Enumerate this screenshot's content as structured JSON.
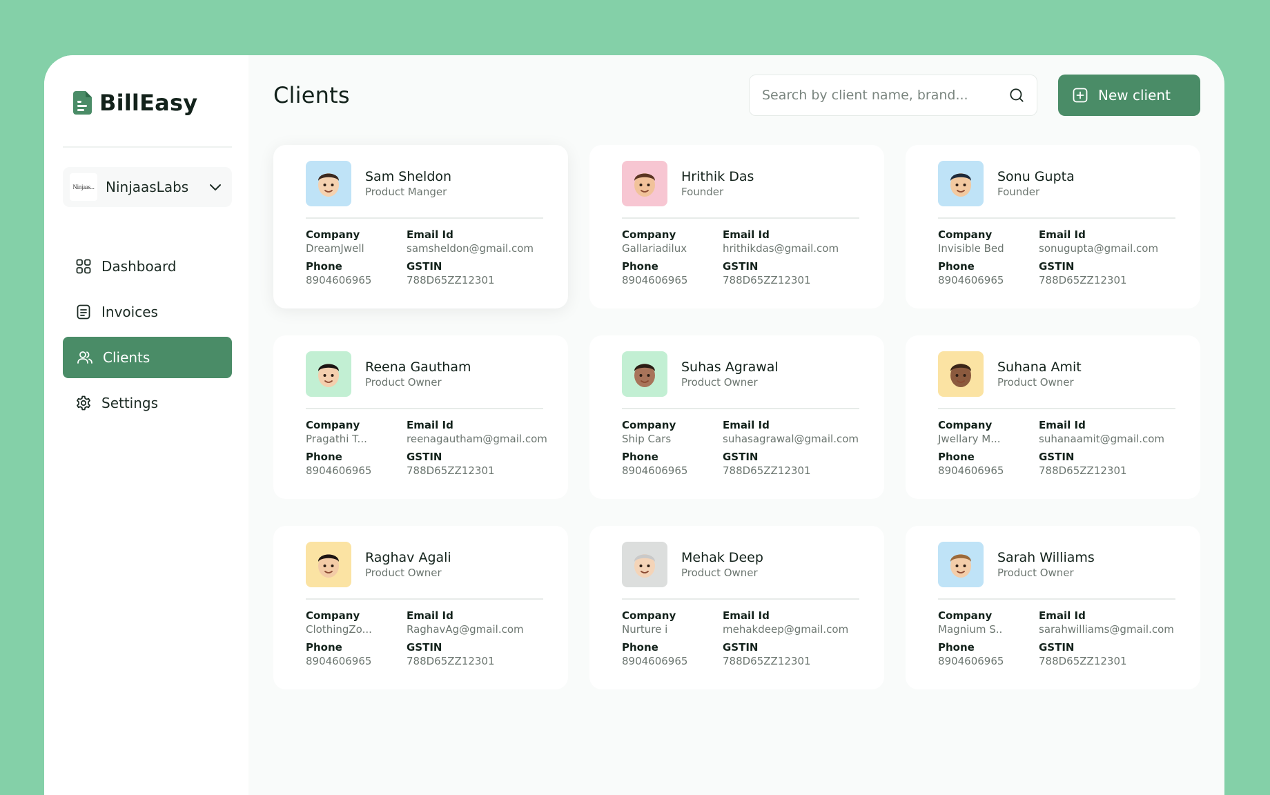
{
  "app": {
    "brand": "BillEasy"
  },
  "org": {
    "logo_text": "Ninjaas...",
    "name": "NinjaasLabs"
  },
  "nav": [
    {
      "label": "Dashboard",
      "icon": "grid-icon",
      "active": false
    },
    {
      "label": "Invoices",
      "icon": "document-icon",
      "active": false
    },
    {
      "label": "Clients",
      "icon": "users-icon",
      "active": true
    },
    {
      "label": "Settings",
      "icon": "gear-icon",
      "active": false
    }
  ],
  "header": {
    "title": "Clients",
    "search_placeholder": "Search by client name, brand...",
    "new_button": "New client"
  },
  "field_labels": {
    "company": "Company",
    "email": "Email Id",
    "phone": "Phone",
    "gstin": "GSTIN"
  },
  "colors": {
    "accent": "#4a8c67",
    "background": "#84d0a8"
  },
  "clients": [
    {
      "name": "Sam Sheldon",
      "role": "Product Manger",
      "company": "DreamJwell",
      "email": "samsheldon@gmail.com",
      "phone": "8904606965",
      "gstin": "788D65ZZ12301",
      "avatar_bg": "#bfe3f7"
    },
    {
      "name": "Hrithik Das",
      "role": "Founder",
      "company": "Gallariadilux",
      "email": "hrithikdas@gmail.com",
      "phone": "8904606965",
      "gstin": "788D65ZZ12301",
      "avatar_bg": "#f7c6d2"
    },
    {
      "name": "Sonu Gupta",
      "role": "Founder",
      "company": "Invisible Bed",
      "email": "sonugupta@gmail.com",
      "phone": "8904606965",
      "gstin": "788D65ZZ12301",
      "avatar_bg": "#bfe3f7"
    },
    {
      "name": "Reena Gautham",
      "role": "Product Owner",
      "company": "Pragathi T...",
      "email": "reenagautham@gmail.com",
      "phone": "8904606965",
      "gstin": "788D65ZZ12301",
      "avatar_bg": "#c2efd3"
    },
    {
      "name": "Suhas Agrawal",
      "role": "Product Owner",
      "company": "Ship Cars",
      "email": "suhasagrawal@gmail.com",
      "phone": "8904606965",
      "gstin": "788D65ZZ12301",
      "avatar_bg": "#c2efd3"
    },
    {
      "name": "Suhana Amit",
      "role": "Product Owner",
      "company": "Jwellary M...",
      "email": "suhanaamit@gmail.com",
      "phone": "8904606965",
      "gstin": "788D65ZZ12301",
      "avatar_bg": "#fbe3a3"
    },
    {
      "name": "Raghav Agali",
      "role": "Product Owner",
      "company": "ClothingZo...",
      "email": "RaghavAg@gmail.com",
      "phone": "8904606965",
      "gstin": "788D65ZZ12301",
      "avatar_bg": "#fbe3a3"
    },
    {
      "name": "Mehak Deep",
      "role": "Product Owner",
      "company": "Nurture i",
      "email": "mehakdeep@gmail.com",
      "phone": "8904606965",
      "gstin": "788D65ZZ12301",
      "avatar_bg": "#dcdedd"
    },
    {
      "name": "Sarah Williams",
      "role": "Product Owner",
      "company": "Magnium S..",
      "email": "sarahwilliams@gmail.com",
      "phone": "8904606965",
      "gstin": "788D65ZZ12301",
      "avatar_bg": "#bfe3f7"
    }
  ]
}
